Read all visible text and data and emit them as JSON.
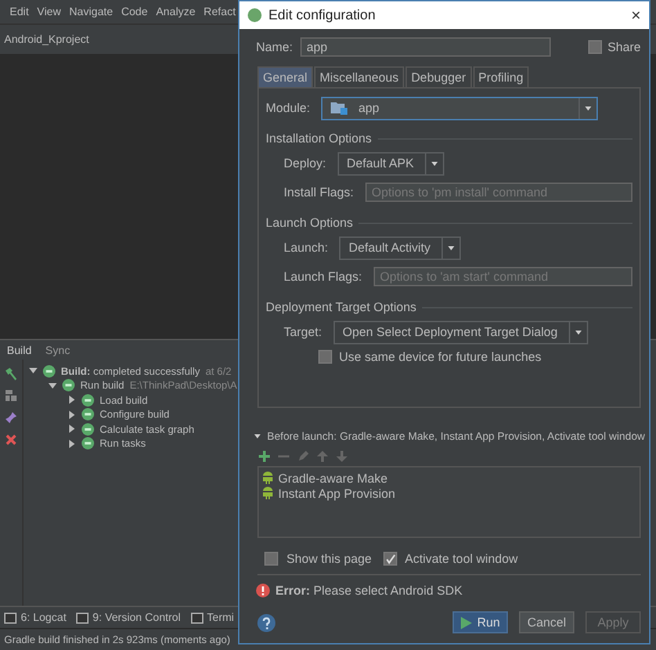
{
  "menu": [
    "Edit",
    "View",
    "Navigate",
    "Code",
    "Analyze",
    "Refact"
  ],
  "project_title": "Android_Kproject",
  "build_panel": {
    "tabs": [
      {
        "label": "Build",
        "selected": true
      },
      {
        "label": "Sync",
        "selected": false
      }
    ],
    "tree": [
      {
        "label": "**Build:** completed successfully",
        "detail": "at 6/2",
        "expanded": true,
        "children": [
          {
            "label": "Run build",
            "detail": "E:\\ThinkPad\\Desktop\\A",
            "expanded": true,
            "children": [
              {
                "label": "Load build",
                "expanded": false
              },
              {
                "label": "Configure build",
                "expanded": false
              },
              {
                "label": "Calculate task graph",
                "expanded": false
              },
              {
                "label": "Run tasks",
                "expanded": false
              }
            ]
          }
        ]
      }
    ]
  },
  "bottom_tools": [
    "6: Logcat",
    "9: Version Control",
    "Termi"
  ],
  "status_bar": "Gradle build finished in 2s 923ms (moments ago)",
  "dialog": {
    "title": "Edit configuration",
    "close": "×",
    "name": {
      "label": "Name:",
      "value": "app"
    },
    "share": {
      "label": "Share",
      "checked": false
    },
    "tabs": [
      {
        "label": "General",
        "selected": true
      },
      {
        "label": "Miscellaneous",
        "selected": false
      },
      {
        "label": "Debugger",
        "selected": false
      },
      {
        "label": "Profiling",
        "selected": false
      }
    ],
    "module": {
      "label": "Module:",
      "value": "app"
    },
    "sections": [
      {
        "title": "Installation Options",
        "rows": [
          {
            "kind": "select",
            "label": "Deploy:",
            "value": "Default APK"
          },
          {
            "kind": "text",
            "label": "Install Flags:",
            "placeholder": "Options to 'pm install' command"
          }
        ]
      },
      {
        "title": "Launch Options",
        "rows": [
          {
            "kind": "select",
            "label": "Launch:",
            "value": "Default Activity"
          },
          {
            "kind": "text",
            "label": "Launch Flags:",
            "placeholder": "Options to 'am start' command"
          }
        ]
      },
      {
        "title": "Deployment Target Options",
        "rows": [
          {
            "kind": "select",
            "label": "Target:",
            "value": "Open Select Deployment Target Dialog"
          },
          {
            "kind": "checkbox",
            "label": "Use same device for future launches",
            "checked": false
          }
        ]
      }
    ],
    "before_launch": {
      "title": "Before launch: Gradle-aware Make, Instant App Provision, Activate tool window",
      "expanded": true,
      "tasks": [
        "Gradle-aware Make",
        "Instant App Provision"
      ]
    },
    "options": [
      {
        "label": "Show this page",
        "checked": false
      },
      {
        "label": "Activate tool window",
        "checked": true
      }
    ],
    "error": "**Error:** Please select Android SDK",
    "buttons": [
      {
        "label": "Run",
        "kind": "primary"
      },
      {
        "label": "Cancel",
        "kind": "normal"
      },
      {
        "label": "Apply",
        "kind": "disabled"
      }
    ]
  }
}
